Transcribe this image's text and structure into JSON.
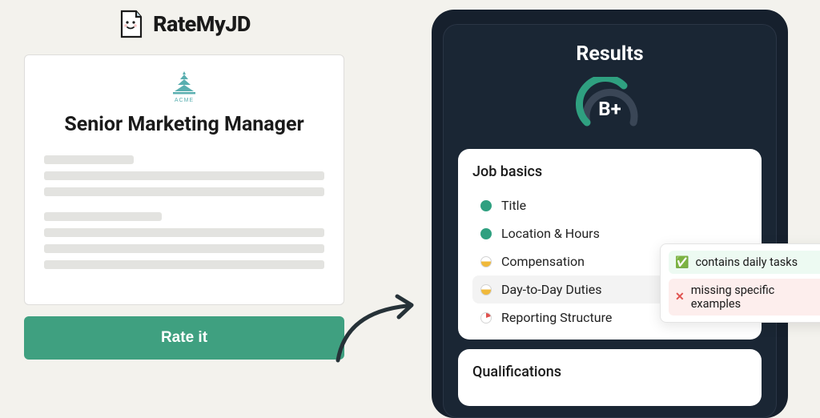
{
  "brand": {
    "name": "RateMyJD"
  },
  "job": {
    "company": "ACME",
    "title": "Senior Marketing Manager"
  },
  "actions": {
    "rate_label": "Rate it"
  },
  "results": {
    "title": "Results",
    "grade": "B+",
    "sections": [
      {
        "name": "Job basics",
        "items": [
          {
            "label": "Title",
            "status": "green"
          },
          {
            "label": "Location & Hours",
            "status": "green"
          },
          {
            "label": "Compensation",
            "status": "yellow"
          },
          {
            "label": "Day-to-Day Duties",
            "status": "yellow",
            "hovered": true
          },
          {
            "label": "Reporting Structure",
            "status": "red"
          }
        ]
      },
      {
        "name": "Qualifications",
        "items": []
      }
    ]
  },
  "tooltip": {
    "ok": "contains daily tasks",
    "bad": "missing specific examples"
  }
}
